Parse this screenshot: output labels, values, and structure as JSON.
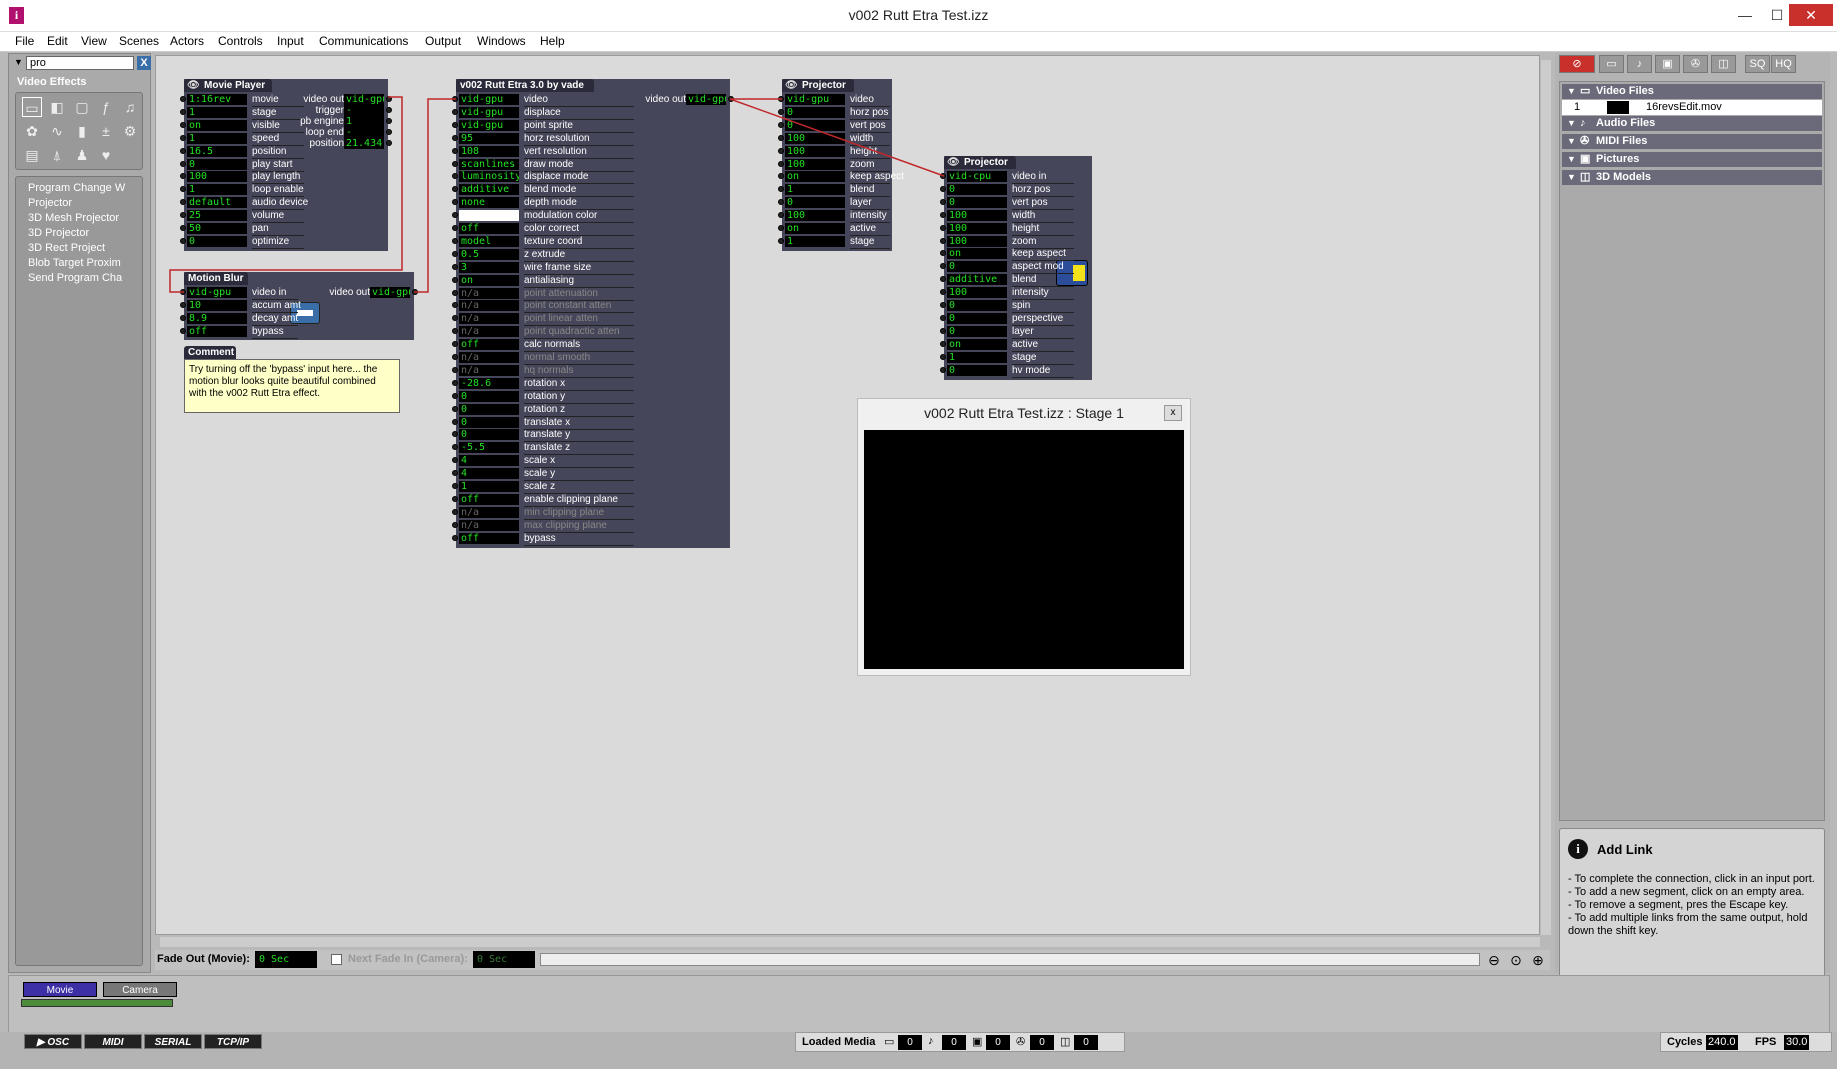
{
  "window": {
    "title": "v002 Rutt Etra Test.izz",
    "app_icon": "i",
    "minimize": "—",
    "maximize": "☐",
    "close": "✕"
  },
  "menu": [
    "File",
    "Edit",
    "View",
    "Scenes",
    "Actors",
    "Controls",
    "Input",
    "Communications",
    "Output",
    "Windows",
    "Help"
  ],
  "left": {
    "search_value": "pro",
    "clear_label": "X",
    "category": "Video Effects",
    "actors": [
      "Program Change W",
      "Projector",
      "3D Mesh Projector",
      "3D Projector",
      "3D Rect Project",
      "Blob Target Proxim",
      "Send Program Cha"
    ]
  },
  "movie_player": {
    "title": "Movie Player",
    "inputs": [
      {
        "v": "1:16rev",
        "n": "movie"
      },
      {
        "v": "1",
        "n": "stage"
      },
      {
        "v": "on",
        "n": "visible"
      },
      {
        "v": "1",
        "n": "speed"
      },
      {
        "v": "16.5",
        "n": "position"
      },
      {
        "v": "0",
        "n": "play start"
      },
      {
        "v": "100",
        "n": "play length"
      },
      {
        "v": "1",
        "n": "loop enable"
      },
      {
        "v": "default",
        "n": "audio device"
      },
      {
        "v": "25",
        "n": "volume"
      },
      {
        "v": "50",
        "n": "pan"
      },
      {
        "v": "0",
        "n": "optimize"
      }
    ],
    "outputs": [
      {
        "n": "video out",
        "v": "vid-gpu"
      },
      {
        "n": "trigger",
        "v": "-"
      },
      {
        "n": "pb engine",
        "v": "1"
      },
      {
        "n": "loop end",
        "v": "-"
      },
      {
        "n": "position",
        "v": "21.434"
      }
    ]
  },
  "motion_blur": {
    "title": "Motion Blur",
    "inputs": [
      {
        "v": "vid-gpu",
        "n": "video in"
      },
      {
        "v": "10",
        "n": "accum amt"
      },
      {
        "v": "8.9",
        "n": "decay amt"
      },
      {
        "v": "off",
        "n": "bypass"
      }
    ],
    "outputs": [
      {
        "n": "video out",
        "v": "vid-gpu"
      }
    ]
  },
  "comment": {
    "title": "Comment",
    "text": "Try turning off the 'bypass' input here... the motion blur looks quite beautiful combined with the v002 Rutt Etra effect."
  },
  "rutt_etra": {
    "title": "v002 Rutt Etra 3.0 by vade",
    "inputs": [
      {
        "v": "vid-gpu",
        "n": "video"
      },
      {
        "v": "vid-gpu",
        "n": "displace"
      },
      {
        "v": "vid-gpu",
        "n": "point sprite"
      },
      {
        "v": "95",
        "n": "horz resolution"
      },
      {
        "v": "108",
        "n": "vert resolution"
      },
      {
        "v": "scanlines",
        "n": "draw mode"
      },
      {
        "v": "luminosity",
        "n": "displace mode"
      },
      {
        "v": "additive",
        "n": "blend mode"
      },
      {
        "v": "none",
        "n": "depth mode"
      },
      {
        "v": "",
        "n": "modulation color",
        "white": true
      },
      {
        "v": "off",
        "n": "color correct"
      },
      {
        "v": "model",
        "n": "texture coord"
      },
      {
        "v": "0.5",
        "n": "z extrude"
      },
      {
        "v": "3",
        "n": "wire frame size"
      },
      {
        "v": "on",
        "n": "antialiasing"
      },
      {
        "v": "n/a",
        "n": "point attenuation",
        "dim": true
      },
      {
        "v": "n/a",
        "n": "point constant atten",
        "dim": true
      },
      {
        "v": "n/a",
        "n": "point linear atten",
        "dim": true
      },
      {
        "v": "n/a",
        "n": "point quadractic atten",
        "dim": true
      },
      {
        "v": "off",
        "n": "calc normals"
      },
      {
        "v": "n/a",
        "n": "normal smooth",
        "dim": true
      },
      {
        "v": "n/a",
        "n": "hq normals",
        "dim": true
      },
      {
        "v": "-28.6",
        "n": "rotation x"
      },
      {
        "v": "0",
        "n": "rotation y"
      },
      {
        "v": "0",
        "n": "rotation z"
      },
      {
        "v": "0",
        "n": "translate x"
      },
      {
        "v": "0",
        "n": "translate y"
      },
      {
        "v": "-5.5",
        "n": "translate z"
      },
      {
        "v": "4",
        "n": "scale x"
      },
      {
        "v": "4",
        "n": "scale y"
      },
      {
        "v": "1",
        "n": "scale z"
      },
      {
        "v": "off",
        "n": "enable clipping plane"
      },
      {
        "v": "n/a",
        "n": "min clipping plane",
        "dim": true
      },
      {
        "v": "n/a",
        "n": "max clipping plane",
        "dim": true
      },
      {
        "v": "off",
        "n": "bypass"
      }
    ],
    "outputs": [
      {
        "n": "video out",
        "v": "vid-gpu"
      }
    ]
  },
  "projector1": {
    "title": "Projector",
    "inputs": [
      {
        "v": "vid-gpu",
        "n": "video"
      },
      {
        "v": "0",
        "n": "horz pos"
      },
      {
        "v": "0",
        "n": "vert pos"
      },
      {
        "v": "100",
        "n": "width"
      },
      {
        "v": "100",
        "n": "height"
      },
      {
        "v": "100",
        "n": "zoom"
      },
      {
        "v": "on",
        "n": "keep aspect"
      },
      {
        "v": "1",
        "n": "blend"
      },
      {
        "v": "0",
        "n": "layer"
      },
      {
        "v": "100",
        "n": "intensity"
      },
      {
        "v": "on",
        "n": "active"
      },
      {
        "v": "1",
        "n": "stage"
      }
    ]
  },
  "projector2": {
    "title": "Projector",
    "inputs": [
      {
        "v": "vid-cpu",
        "n": "video in"
      },
      {
        "v": "0",
        "n": "horz pos"
      },
      {
        "v": "0",
        "n": "vert pos"
      },
      {
        "v": "100",
        "n": "width"
      },
      {
        "v": "100",
        "n": "height"
      },
      {
        "v": "100",
        "n": "zoom"
      },
      {
        "v": "on",
        "n": "keep aspect"
      },
      {
        "v": "0",
        "n": "aspect mod"
      },
      {
        "v": "additive",
        "n": "blend"
      },
      {
        "v": "100",
        "n": "intensity"
      },
      {
        "v": "0",
        "n": "spin"
      },
      {
        "v": "0",
        "n": "perspective"
      },
      {
        "v": "0",
        "n": "layer"
      },
      {
        "v": "on",
        "n": "active"
      },
      {
        "v": "1",
        "n": "stage"
      },
      {
        "v": "0",
        "n": "hv mode"
      }
    ]
  },
  "stage_window": {
    "title": "v002 Rutt Etra Test.izz : Stage 1",
    "close": "x"
  },
  "right": {
    "toolbar": [
      "SQ",
      "HQ"
    ],
    "sections": [
      "Video Files",
      "Audio Files",
      "MIDI Files",
      "Pictures",
      "3D Models"
    ],
    "video_file": {
      "num": "1",
      "name": "16revsEdit.mov"
    }
  },
  "info": {
    "title": "Add Link",
    "lines": [
      "- To complete the connection, click in an input port.",
      "- To add a new segment, click on an empty area.",
      "- To remove a segment, pres the Escape key.",
      "- To add multiple links from the same output, hold down the shift key."
    ]
  },
  "fade": {
    "out_label": "Fade Out (Movie):",
    "out_value": "0 Sec",
    "in_label": "Next Fade In (Camera):",
    "in_value": "0 Sec"
  },
  "scenes": [
    "Movie",
    "Camera"
  ],
  "status": {
    "buttons": [
      "OSC",
      "MIDI",
      "SERIAL",
      "TCP/IP"
    ],
    "loaded_label": "Loaded Media",
    "loaded_counts": [
      "0",
      "0",
      "0",
      "0",
      "0"
    ],
    "cycles_label": "Cycles",
    "cycles_value": "240.0",
    "fps_label": "FPS",
    "fps_value": "30.0"
  },
  "colors": {
    "wire": "#c0282a",
    "value_text": "#22e022",
    "actor_bg": "#46465a",
    "scene_active": "#3d2fa5"
  }
}
